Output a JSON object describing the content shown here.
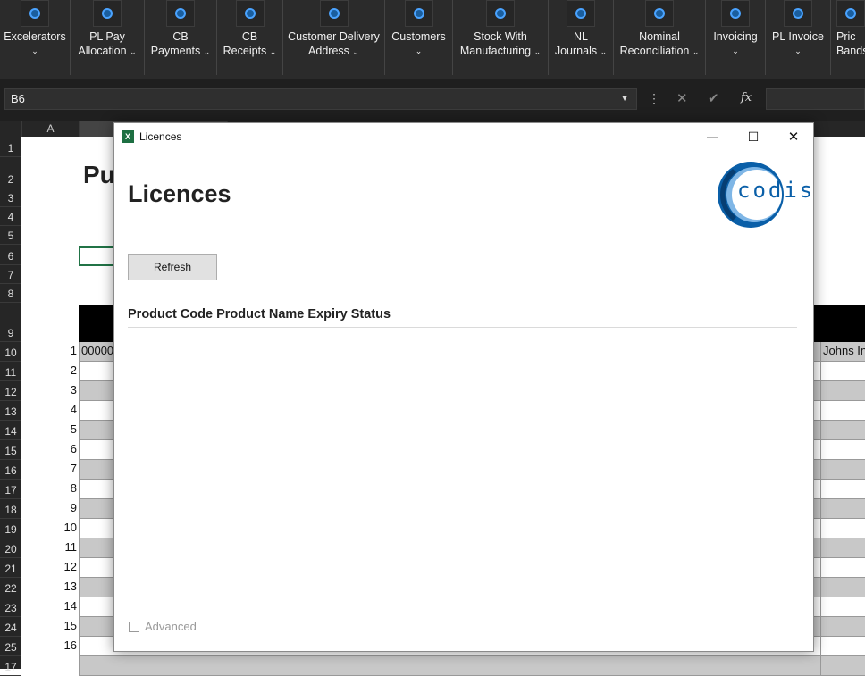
{
  "ribbon": {
    "groups": [
      {
        "line1": "Excelerators",
        "line2": ""
      },
      {
        "line1": "PL Pay",
        "line2": "Allocation"
      },
      {
        "line1": "CB",
        "line2": "Payments"
      },
      {
        "line1": "CB",
        "line2": "Receipts"
      },
      {
        "line1": "Customer Delivery",
        "line2": "Address"
      },
      {
        "line1": "Customers",
        "line2": ""
      },
      {
        "line1": "Stock With",
        "line2": "Manufacturing"
      },
      {
        "line1": "NL",
        "line2": "Journals"
      },
      {
        "line1": "Nominal",
        "line2": "Reconciliation"
      },
      {
        "line1": "Invoicing",
        "line2": ""
      },
      {
        "line1": "PL Invoice",
        "line2": ""
      },
      {
        "line1": "Pric",
        "line2": "Bands"
      }
    ],
    "dropdown_glyph": "⌄"
  },
  "formula_bar": {
    "name_box": "B6",
    "more_glyph": "⋮",
    "cancel_glyph": "✕",
    "enter_glyph": "✔",
    "fx_glyph": "fx"
  },
  "sheet": {
    "column_a": "A",
    "title_fragment": "Pu",
    "cell_b10_fragment": "00000",
    "right_cell_fragment": "Johns In",
    "row_headers": [
      "1",
      "2",
      "3",
      "4",
      "5",
      "6",
      "7",
      "8",
      "9",
      "10",
      "11",
      "12",
      "13",
      "14",
      "15",
      "16",
      "17",
      "18",
      "19",
      "20",
      "21",
      "22",
      "23",
      "24",
      "25",
      "17"
    ],
    "line_numbers": [
      "1",
      "2",
      "3",
      "4",
      "5",
      "6",
      "7",
      "8",
      "9",
      "10",
      "11",
      "12",
      "13",
      "14",
      "15",
      "16"
    ]
  },
  "dialog": {
    "window_title": "Licences",
    "app_icon_letter": "X",
    "minimize_glyph": "—",
    "maximize_glyph": "☐",
    "close_glyph": "✕",
    "heading": "Licences",
    "logo_text": "codis",
    "refresh_label": "Refresh",
    "columns": [
      "Product Code",
      "Product Name",
      "Expiry",
      "Status"
    ],
    "advanced_label": "Advanced",
    "advanced_checked": false
  },
  "colors": {
    "ribbon_bg": "#2b2b2b",
    "excel_green": "#217346",
    "accent_blue": "#4aa3ff",
    "logo_blue": "#0a5fa8"
  }
}
